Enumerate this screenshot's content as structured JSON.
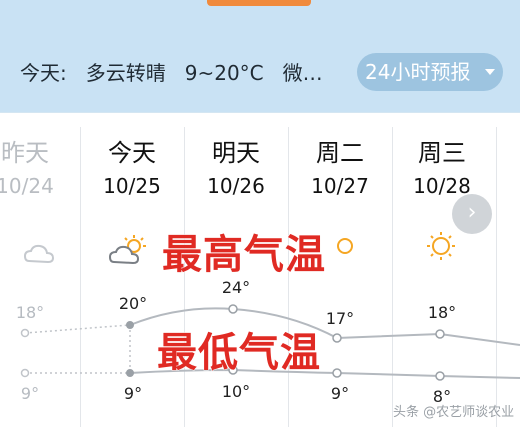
{
  "header": {
    "today_label": "今天:",
    "condition": "多云转晴",
    "temp_range": "9~20°C",
    "wind_truncated": "微…",
    "forecast_button": "24小时预报"
  },
  "days": [
    {
      "day": "昨天",
      "date": "10/24",
      "icon": "cloud-icon",
      "high": "18°",
      "low": "9°",
      "past": true
    },
    {
      "day": "今天",
      "date": "10/25",
      "icon": "partly-cloudy-icon",
      "high": "20°",
      "low": "9°"
    },
    {
      "day": "明天",
      "date": "10/26",
      "icon": "none",
      "high": "24°",
      "low": "10°"
    },
    {
      "day": "周二",
      "date": "10/27",
      "icon": "sun-icon",
      "high": "17°",
      "low": "9°"
    },
    {
      "day": "周三",
      "date": "10/28",
      "icon": "sun-icon",
      "high": "18°",
      "low": "8°"
    }
  ],
  "overlay": {
    "high_label": "最高气温",
    "low_label": "最低气温"
  },
  "watermark": "头条 @农艺师谈农业",
  "colors": {
    "header_bg": "#c9e2f4",
    "button_bg": "#9dc4e0",
    "overlay_text": "#e02a23",
    "sun": "#f5a623"
  }
}
